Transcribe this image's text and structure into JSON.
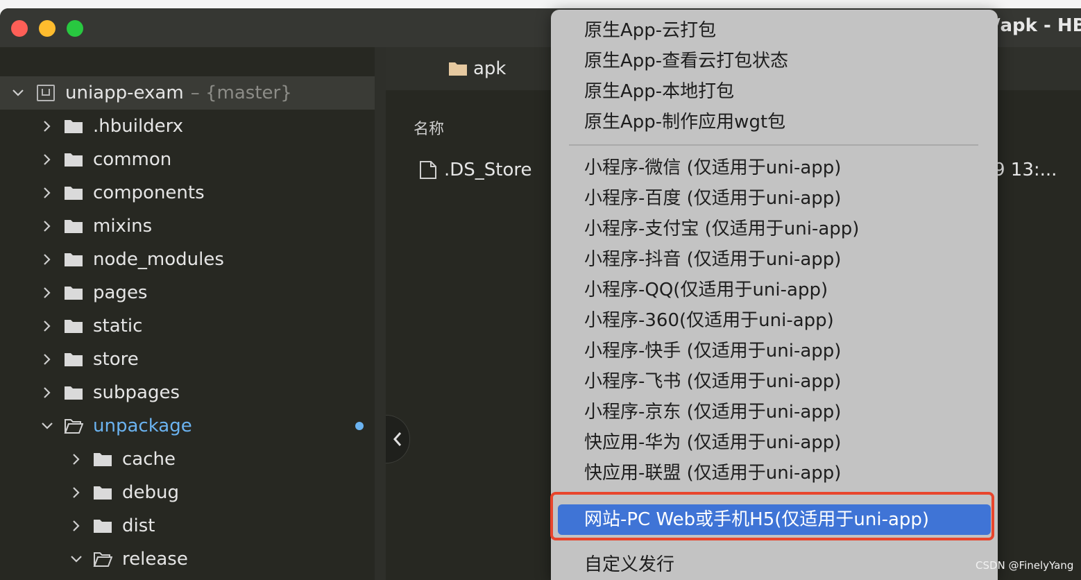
{
  "window": {
    "title": "/apk - HBu",
    "traffic_colors": {
      "close": "#fe5f57",
      "minimize": "#febc2e",
      "zoom": "#28c840"
    }
  },
  "sidebar": {
    "project": {
      "name": "uniapp-exam",
      "branch": "– {master}"
    },
    "folders": [
      {
        "label": ".hbuilderx"
      },
      {
        "label": "common"
      },
      {
        "label": "components"
      },
      {
        "label": "mixins"
      },
      {
        "label": "node_modules"
      },
      {
        "label": "pages"
      },
      {
        "label": "static"
      },
      {
        "label": "store"
      },
      {
        "label": "subpages"
      }
    ],
    "open_folder": {
      "label": "unpackage",
      "color": "#6bb3f0"
    },
    "subfolders": [
      {
        "label": "cache"
      },
      {
        "label": "debug"
      },
      {
        "label": "dist"
      }
    ],
    "open_subfolder": {
      "label": "release"
    }
  },
  "main": {
    "folder": "apk",
    "column_name": "名称",
    "file": ".DS_Store",
    "date_fragment": "9 13:..."
  },
  "menu": {
    "group1": [
      {
        "label": "原生App-云打包"
      },
      {
        "label": "原生App-查看云打包状态"
      },
      {
        "label": "原生App-本地打包"
      },
      {
        "label": "原生App-制作应用wgt包"
      }
    ],
    "group2": [
      {
        "label": "小程序-微信 (仅适用于uni-app)"
      },
      {
        "label": "小程序-百度 (仅适用于uni-app)"
      },
      {
        "label": "小程序-支付宝 (仅适用于uni-app)"
      },
      {
        "label": "小程序-抖音 (仅适用于uni-app)"
      },
      {
        "label": "小程序-QQ(仅适用于uni-app)"
      },
      {
        "label": "小程序-360(仅适用于uni-app)"
      },
      {
        "label": "小程序-快手 (仅适用于uni-app)"
      },
      {
        "label": "小程序-飞书 (仅适用于uni-app)"
      },
      {
        "label": "小程序-京东 (仅适用于uni-app)"
      },
      {
        "label": "快应用-华为 (仅适用于uni-app)"
      },
      {
        "label": "快应用-联盟 (仅适用于uni-app)"
      }
    ],
    "highlighted": {
      "label": "网站-PC Web或手机H5(仅适用于uni-app)",
      "color": "#3f74d6"
    },
    "last": {
      "label": "自定义发行"
    }
  },
  "watermark": "CSDN @FinelyYang",
  "highlight_border_color": "#e8452c"
}
